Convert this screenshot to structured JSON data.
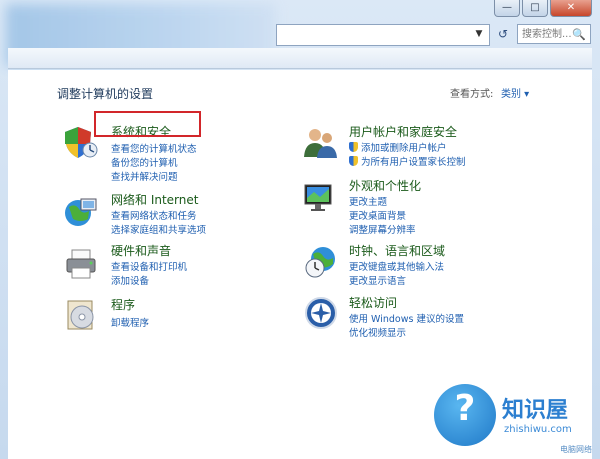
{
  "window": {
    "controls": {
      "minimize": "—",
      "maximize": "□",
      "close": "✕"
    }
  },
  "address": {
    "search_placeholder": "搜索控制...",
    "refresh_symbol": "↺"
  },
  "header": {
    "title": "调整计算机的设置",
    "view_label": "查看方式:",
    "view_value": "类别 ▾"
  },
  "categories": [
    {
      "title": "系统和安全",
      "links": [
        "查看您的计算机状态",
        "备份您的计算机",
        "查找并解决问题"
      ],
      "icon": "security-shield-icon"
    },
    {
      "title": "网络和 Internet",
      "links": [
        "查看网络状态和任务",
        "选择家庭组和共享选项"
      ],
      "icon": "network-globe-icon"
    },
    {
      "title": "硬件和声音",
      "links": [
        "查看设备和打印机",
        "添加设备"
      ],
      "icon": "printer-icon"
    },
    {
      "title": "程序",
      "links": [
        "卸载程序"
      ],
      "icon": "programs-disc-icon"
    },
    {
      "title": "用户帐户和家庭安全",
      "links": [
        "添加或删除用户帐户",
        "为所有用户设置家长控制"
      ],
      "icon": "users-icon"
    },
    {
      "title": "外观和个性化",
      "links": [
        "更改主题",
        "更改桌面背景",
        "调整屏幕分辨率"
      ],
      "icon": "monitor-icon"
    },
    {
      "title": "时钟、语言和区域",
      "links": [
        "更改键盘或其他输入法",
        "更改显示语言"
      ],
      "icon": "clock-globe-icon"
    },
    {
      "title": "轻松访问",
      "links": [
        "使用 Windows 建议的设置",
        "优化视频显示"
      ],
      "icon": "accessibility-icon"
    }
  ],
  "watermark": {
    "text": "知识屋",
    "url": "zhishiwu.com",
    "symbol": "?",
    "corner": "电脑网络"
  },
  "colors": {
    "title_green": "#1a5a1a",
    "link_blue": "#1f5fb0",
    "highlight_red": "#d2262a"
  }
}
